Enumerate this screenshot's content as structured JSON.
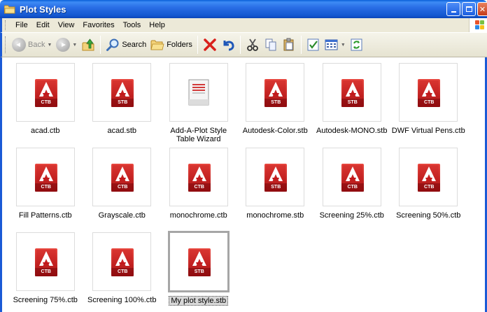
{
  "window": {
    "title": "Plot Styles"
  },
  "menu": [
    "File",
    "Edit",
    "View",
    "Favorites",
    "Tools",
    "Help"
  ],
  "toolbar": {
    "back_label": "Back",
    "search_label": "Search",
    "folders_label": "Folders"
  },
  "files": [
    {
      "name": "acad.ctb",
      "badge": "CTB",
      "type": "autocad"
    },
    {
      "name": "acad.stb",
      "badge": "STB",
      "type": "autocad"
    },
    {
      "name": "Add-A-Plot Style Table Wizard",
      "badge": "",
      "type": "wizard"
    },
    {
      "name": "Autodesk-Color.stb",
      "badge": "STB",
      "type": "autocad"
    },
    {
      "name": "Autodesk-MONO.stb",
      "badge": "STB",
      "type": "autocad"
    },
    {
      "name": "DWF Virtual Pens.ctb",
      "badge": "CTB",
      "type": "autocad"
    },
    {
      "name": "Fill Patterns.ctb",
      "badge": "CTB",
      "type": "autocad"
    },
    {
      "name": "Grayscale.ctb",
      "badge": "CTB",
      "type": "autocad"
    },
    {
      "name": "monochrome.ctb",
      "badge": "CTB",
      "type": "autocad"
    },
    {
      "name": "monochrome.stb",
      "badge": "STB",
      "type": "autocad"
    },
    {
      "name": "Screening 25%.ctb",
      "badge": "CTB",
      "type": "autocad"
    },
    {
      "name": "Screening 50%.ctb",
      "badge": "CTB",
      "type": "autocad"
    },
    {
      "name": "Screening 75%.ctb",
      "badge": "CTB",
      "type": "autocad"
    },
    {
      "name": "Screening 100%.ctb",
      "badge": "CTB",
      "type": "autocad"
    },
    {
      "name": "My plot style.stb",
      "badge": "STB",
      "type": "autocad",
      "selected": true
    }
  ]
}
